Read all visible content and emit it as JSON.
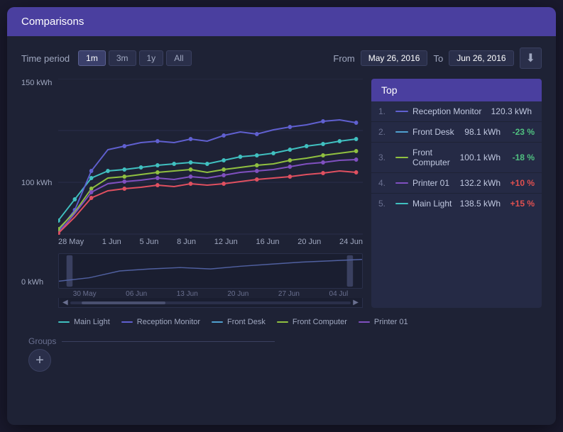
{
  "window": {
    "title": "Comparisons"
  },
  "toolbar": {
    "time_period_label": "Time period",
    "periods": [
      "1m",
      "3m",
      "1y",
      "All"
    ],
    "active_period": "1m",
    "from_label": "From",
    "from_date": "May 26, 2016",
    "to_label": "To",
    "to_date": "Jun 26, 2016"
  },
  "top_panel": {
    "header": "Top",
    "items": [
      {
        "rank": "1.",
        "name": "Reception Monitor",
        "value": "120.3 kWh",
        "change": "",
        "change_type": "none",
        "color": "#6060d0"
      },
      {
        "rank": "2.",
        "name": "Front Desk",
        "value": "98.1 kWh",
        "change": "-23 %",
        "change_type": "neg",
        "color": "#50a0d0"
      },
      {
        "rank": "3.",
        "name": "Front Computer",
        "value": "100.1 kWh",
        "change": "-18 %",
        "change_type": "neg",
        "color": "#90c040"
      },
      {
        "rank": "4.",
        "name": "Printer 01",
        "value": "132.2 kWh",
        "change": "+10 %",
        "change_type": "pos",
        "color": "#8050c0"
      },
      {
        "rank": "5.",
        "name": "Main Light",
        "value": "138.5 kWh",
        "change": "+15 %",
        "change_type": "pos",
        "color": "#40c0c0"
      }
    ]
  },
  "y_axis": {
    "labels": [
      "150 kWh",
      "100 kWh",
      "0 kWh"
    ]
  },
  "x_axis": {
    "labels": [
      "28 May",
      "1 Jun",
      "5 Jun",
      "8 Jun",
      "12 Jun",
      "16 Jun",
      "20 Jun",
      "24 Jun"
    ]
  },
  "mini_x_axis": {
    "labels": [
      "30 May",
      "06 Jun",
      "13 Jun",
      "20 Jun",
      "27 Jun",
      "04 Jul"
    ]
  },
  "legend": {
    "items": [
      {
        "label": "Main Light",
        "color": "#40c0c0"
      },
      {
        "label": "Reception Monitor",
        "color": "#6060d0"
      },
      {
        "label": "Front Desk",
        "color": "#50a0d0"
      },
      {
        "label": "Front Computer",
        "color": "#90c040"
      },
      {
        "label": "Printer 01",
        "color": "#8050c0"
      }
    ]
  },
  "groups": {
    "label": "Groups",
    "add_label": "+"
  }
}
